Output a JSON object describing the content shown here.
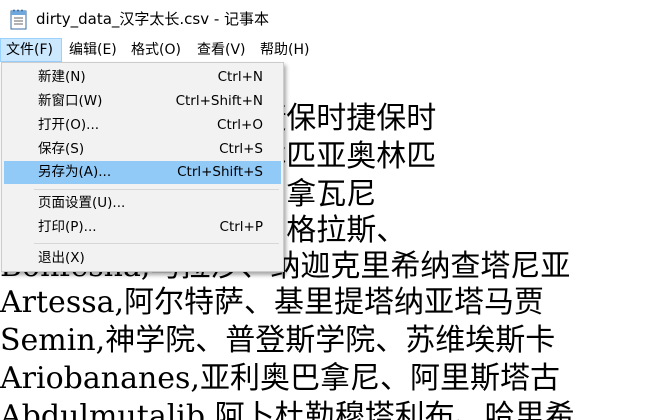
{
  "window": {
    "title": "dirty_data_汉字太长.csv - 记事本",
    "icon": "notepad-icon"
  },
  "menubar": [
    {
      "label": "文件(F)"
    },
    {
      "label": "编辑(E)"
    },
    {
      "label": "格式(O)"
    },
    {
      "label": "查看(V)"
    },
    {
      "label": "帮助(H)"
    }
  ],
  "file_menu": {
    "items": [
      {
        "label": "新建(N)",
        "shortcut": "Ctrl+N"
      },
      {
        "label": "新窗口(W)",
        "shortcut": "Ctrl+Shift+N"
      },
      {
        "label": "打开(O)...",
        "shortcut": "Ctrl+O"
      },
      {
        "label": "保存(S)",
        "shortcut": "Ctrl+S"
      },
      {
        "label": "另存为(A)...",
        "shortcut": "Ctrl+Shift+S"
      },
      {
        "label": "页面设置(U)...",
        "shortcut": ""
      },
      {
        "label": "打印(P)...",
        "shortcut": "Ctrl+P"
      },
      {
        "label": "退出(X)",
        "shortcut": ""
      }
    ]
  },
  "editor": {
    "lines": [
      "        捷保时捷保时捷保时捷保时",
      "        亚奥林匹亚奥林匹亚奥林匹",
      "        人、迦利乌人、拿瓦尼",
      "        托利乌斯、阿纳格拉斯、",
      "Bonfesha,马拉沙、纳迦克里希纳查塔尼亚",
      "Artessa,阿尔特萨、基里提塔纳亚塔马贾",
      "Semin,神学院、普登斯学院、苏维埃斯卡",
      "Ariobananes,亚利奥巴拿尼、阿里斯塔古",
      "Abdulmutalib,阿卜杜勒穆塔利布、哈里希"
    ]
  },
  "colors": {
    "menu_active_bg": "#cce8ff",
    "item_highlight_bg": "#91c9f7",
    "dropdown_bg": "#f2f2f2"
  }
}
